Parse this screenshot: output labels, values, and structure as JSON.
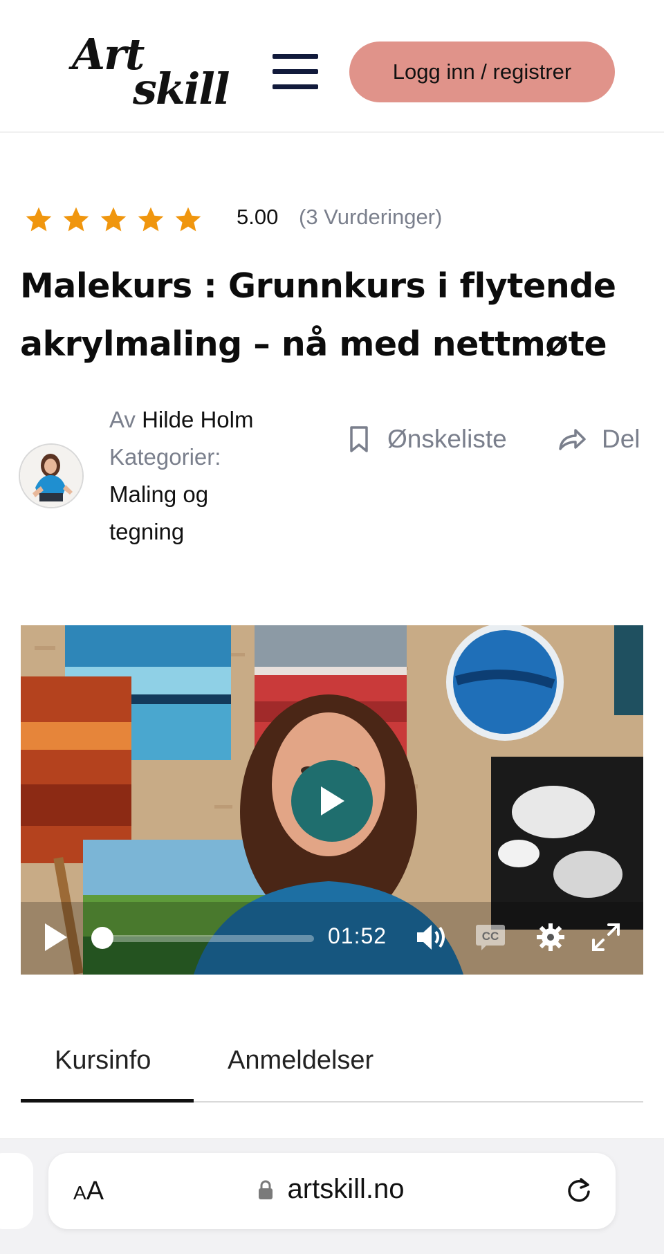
{
  "header": {
    "logo_line1": "Art",
    "logo_line2": "skill",
    "login_label": "Logg inn / registrer"
  },
  "course": {
    "rating": {
      "stars": 5,
      "score": "5.00",
      "count_label": "(3 Vurderinger)"
    },
    "title": "Malekurs : Grunnkurs i flytende akrylmaling – nå med nettmøte",
    "author_prefix": "Av",
    "author_name": "Hilde Holm",
    "categories_label": "Kategorier:",
    "category_line1": "Maling og",
    "category_line2": "tegning",
    "wishlist_label": "Ønskeliste",
    "share_label": "Del"
  },
  "video": {
    "time": "01:52",
    "progress_fraction": 0.0,
    "accent_color": "#1f6e6e"
  },
  "tabs": [
    {
      "label": "Kursinfo",
      "active": true
    },
    {
      "label": "Anmeldelser",
      "active": false
    }
  ],
  "browser": {
    "text_size_small": "A",
    "text_size_big": "A",
    "url": "artskill.no"
  },
  "colors": {
    "login_button": "#e0938a",
    "star": "#f0960e",
    "muted_text": "#7a7f8c"
  }
}
